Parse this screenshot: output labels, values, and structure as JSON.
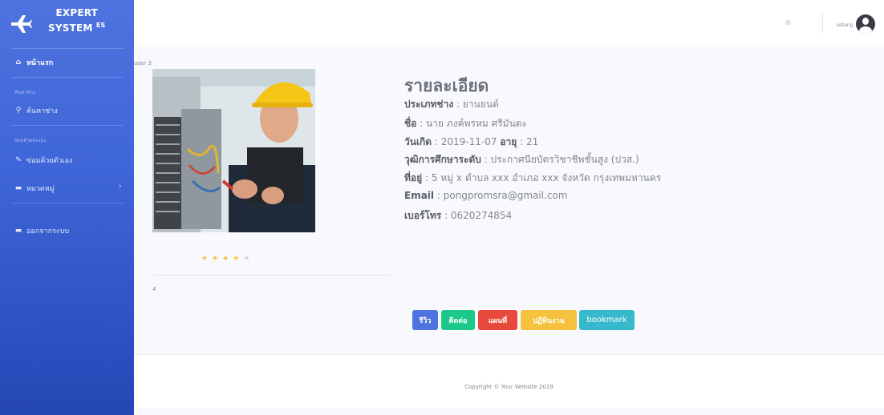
{
  "brand": {
    "line1": "EXPERT",
    "line2": "SYSTEM",
    "sup": "ES"
  },
  "sidebar": {
    "home": "หน้าแรก",
    "heading1": "ค้นหาช่าง",
    "search": "ค้นหาช่าง",
    "heading2": "ซ่อมด้วยตนเอง",
    "diy": "ซ่อมด้วยตัวเอง",
    "category": "หมวดหมู่",
    "logout": "ออกจากระบบ"
  },
  "topbar": {
    "username": "sotang"
  },
  "profile": {
    "user_tag": "user 3",
    "title": "รายละเอียด",
    "type_label": "ประเภทช่าง",
    "type_value": " : ยานยนต์",
    "name_label": "ชื่อ",
    "name_value": " : นาย ภงค์พรหม ศรีมันตะ",
    "birth_label": "วันเกิด",
    "birth_value": " : 2019-11-07 ",
    "age_label": "อายุ",
    "age_value": " : 21",
    "edu_label": "วุฒิการศึกษาระดับ",
    "edu_value": " : ประกาศนียบัตรวิชาชีพชั้นสูง (ปวส.)",
    "addr_label": "ที่อยู่",
    "addr_value": " : 5 หมู่ x ตำบล xxx อำเภอ xxx จังหวัด กรุงเทพมหานคร",
    "email_label": "Email",
    "email_value": " : pongpromsra@gmail.com",
    "phone_label": "เบอร์โทร",
    "phone_value": " : 0620274854",
    "rating": 4,
    "rating_max": 5,
    "rating_count": "4"
  },
  "actions": {
    "review": "รีวิว",
    "contact": "ติดต่อ",
    "map": "แผนที่",
    "calendar": "ปฏิทินงาน",
    "bookmark": "bookmark"
  },
  "colors": {
    "primary": "#4e73df",
    "success": "#1cc88a",
    "danger": "#e74a3b",
    "warning": "#f6c23e",
    "info": "#36b9cc"
  },
  "footer": {
    "copyright": "Copyright © Your Website 2019"
  }
}
